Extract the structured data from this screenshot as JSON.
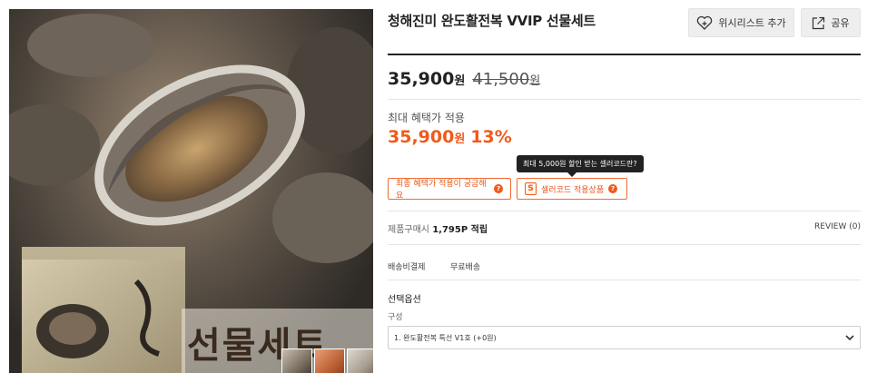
{
  "product": {
    "title": "청해진미 완도활전복 VVIP 선물세트",
    "wishlist_label": "위시리스트 추가",
    "share_label": "공유",
    "price": "35,900",
    "price_unit": "원",
    "original_price": "41,500",
    "original_unit": "원",
    "benefit_label": "최대 혜택가 적용",
    "benefit_price": "35,900",
    "benefit_unit": "원",
    "discount_percent": "13%",
    "tooltip": "최대 5,000원 할인 받는 셀러코드란?",
    "chip_benefit": "최종 혜택가 적용이 궁금해요",
    "chip_seller": "셀러코드 적용상품",
    "seller_badge": "S",
    "qmark": "?",
    "points_prefix": "제품구매시",
    "points_value": "1,795P 적립",
    "review": "REVIEW (0)",
    "shipping_label": "배송비결제",
    "shipping_value": "무료배송",
    "option_title": "선택옵션",
    "option_sub": "구성",
    "option_selected": "1. 완도활전복 특선 V1호 (+0원)",
    "image_text": "선물세트"
  },
  "icons": {
    "wishlist": "heart-plus-icon",
    "share": "external-share-icon",
    "select": "chevron-down-icon"
  },
  "colors": {
    "accent": "#f05a1a",
    "button_bg": "#eeeeee"
  }
}
